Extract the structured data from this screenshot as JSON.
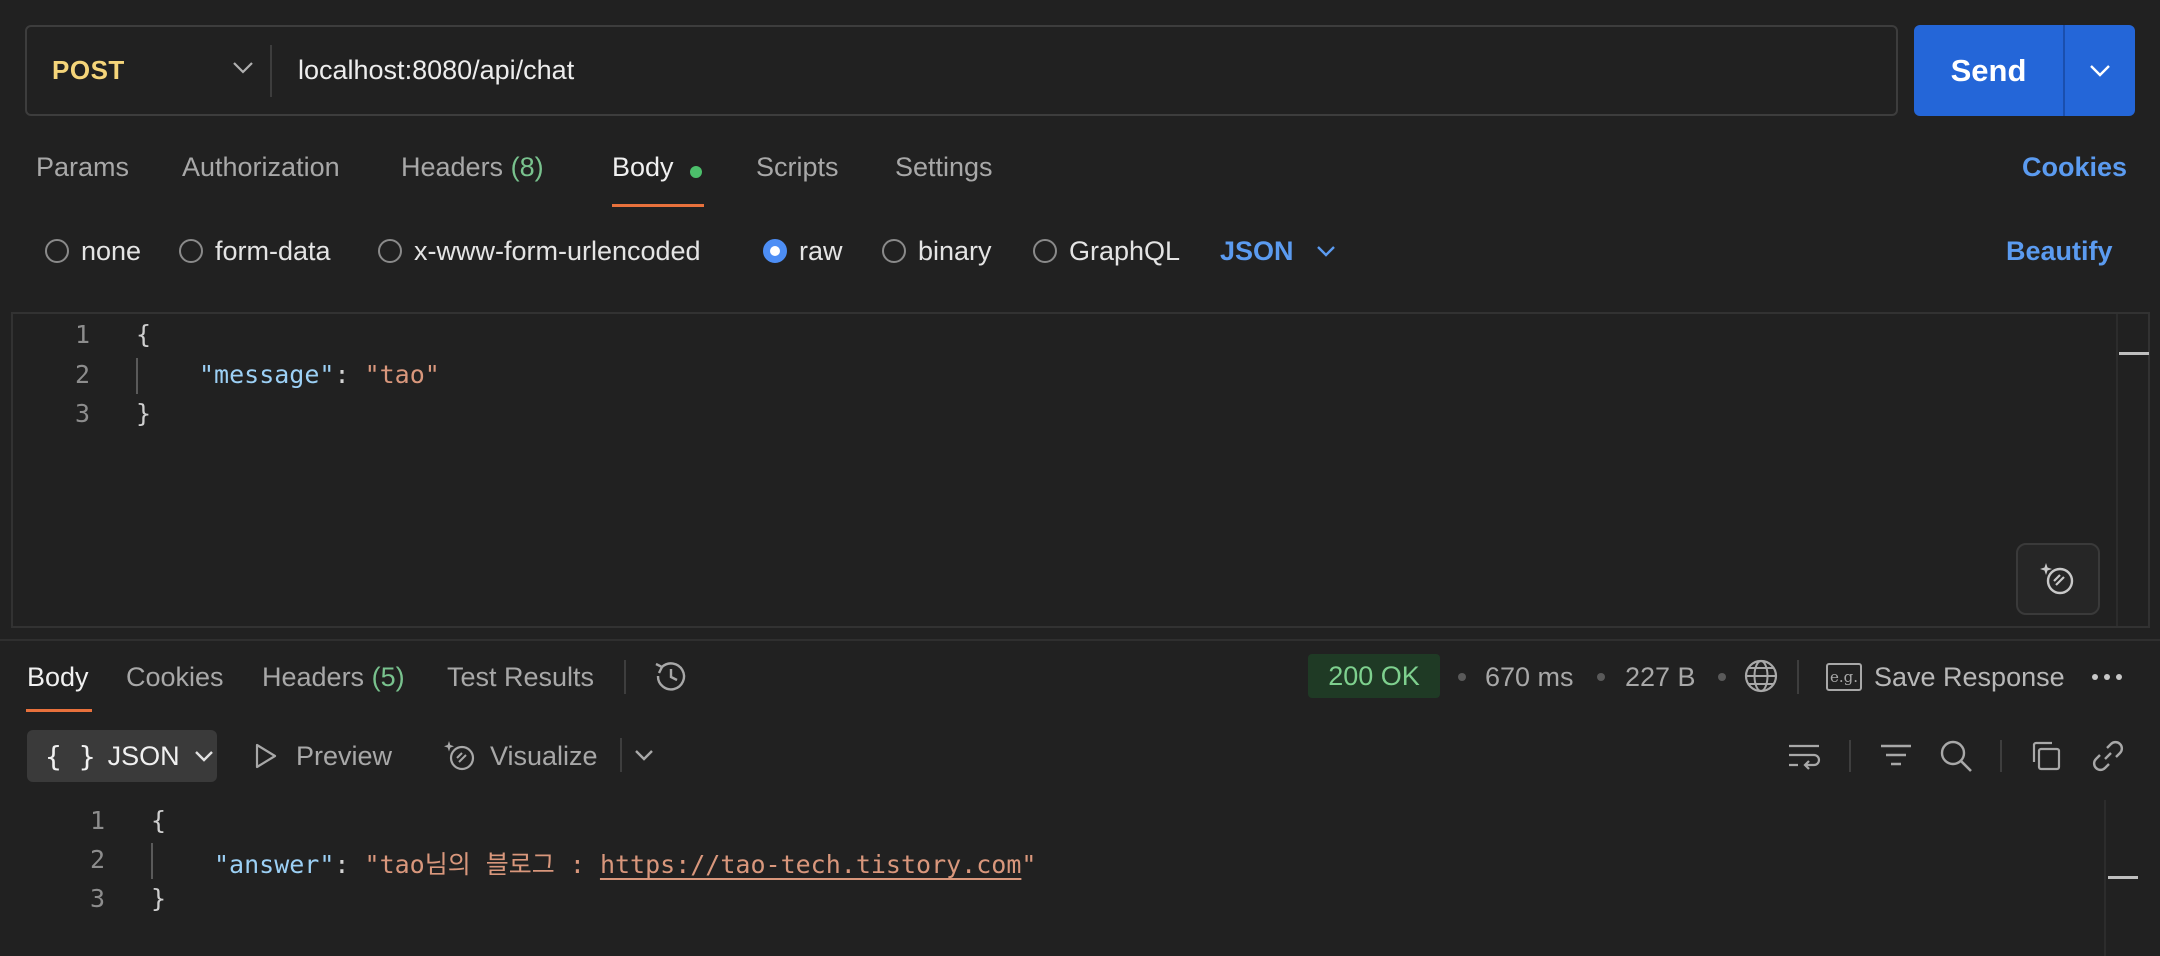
{
  "request": {
    "method": "POST",
    "url": "localhost:8080/api/chat",
    "send_label": "Send",
    "tabs": [
      {
        "label": "Params"
      },
      {
        "label": "Authorization"
      },
      {
        "label": "Headers",
        "count": "(8)"
      },
      {
        "label": "Body",
        "active": true
      },
      {
        "label": "Scripts"
      },
      {
        "label": "Settings"
      }
    ],
    "cookies_label": "Cookies",
    "body_types": [
      "none",
      "form-data",
      "x-www-form-urlencoded",
      "raw",
      "binary",
      "GraphQL"
    ],
    "selected_body_type": "raw",
    "language": "JSON",
    "beautify_label": "Beautify",
    "code": {
      "line_numbers": [
        "1",
        "2",
        "3"
      ],
      "open": "{",
      "key": "\"message\"",
      "colon": ": ",
      "value": "\"tao\"",
      "close": "}"
    }
  },
  "response": {
    "tabs": [
      {
        "label": "Body",
        "active": true
      },
      {
        "label": "Cookies"
      },
      {
        "label": "Headers",
        "count": "(5)"
      },
      {
        "label": "Test Results"
      }
    ],
    "status": "200 OK",
    "time": "670 ms",
    "size": "227 B",
    "eg_icon_text": "e.g.",
    "save_label": "Save Response",
    "format": "JSON",
    "format_icon": "{ }",
    "preview_label": "Preview",
    "visualize_label": "Visualize",
    "code": {
      "line_numbers": [
        "1",
        "2",
        "3"
      ],
      "open": "{",
      "key": "\"answer\"",
      "colon": ": ",
      "value_prefix": "\"tao님의 블로그 : ",
      "link": "https://tao-tech.tistory.com",
      "value_suffix": "\"",
      "close": "}"
    }
  },
  "colors": {
    "accent": "#e8713c",
    "primary": "#2466d8",
    "link": "#5b9bf0",
    "status_ok": "#7ed08e",
    "method_post": "#f5d57a"
  }
}
